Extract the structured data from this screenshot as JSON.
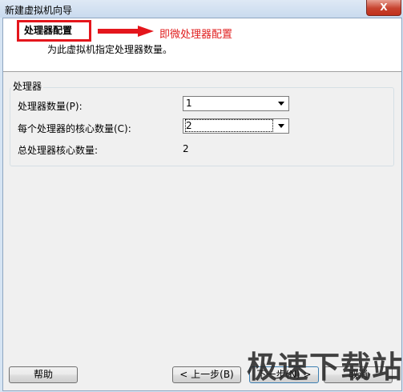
{
  "window": {
    "title": "新建虚拟机向导",
    "close_glyph": "X"
  },
  "header": {
    "title": "处理器配置",
    "annotation": "即微处理器配置",
    "subtitle": "为此虚拟机指定处理器数量。"
  },
  "processor_group": {
    "title": "处理器",
    "num_processors_label": "处理器数量(P):",
    "num_processors_value": "1",
    "cores_per_processor_label": "每个处理器的核心数量(C):",
    "cores_per_processor_value": "2",
    "total_cores_label": "总处理器核心数量:",
    "total_cores_value": "2"
  },
  "buttons": {
    "help": "帮助",
    "back": "< 上一步(B)",
    "next": "下一步(N) >",
    "cancel": "取消"
  },
  "watermark": "极速下载站",
  "colors": {
    "annotation_red": "#e4161c",
    "header_bg": "#ffffff",
    "dialog_bg": "#f0f0f0"
  },
  "icons": {
    "arrow": "red-right-arrow-icon"
  }
}
